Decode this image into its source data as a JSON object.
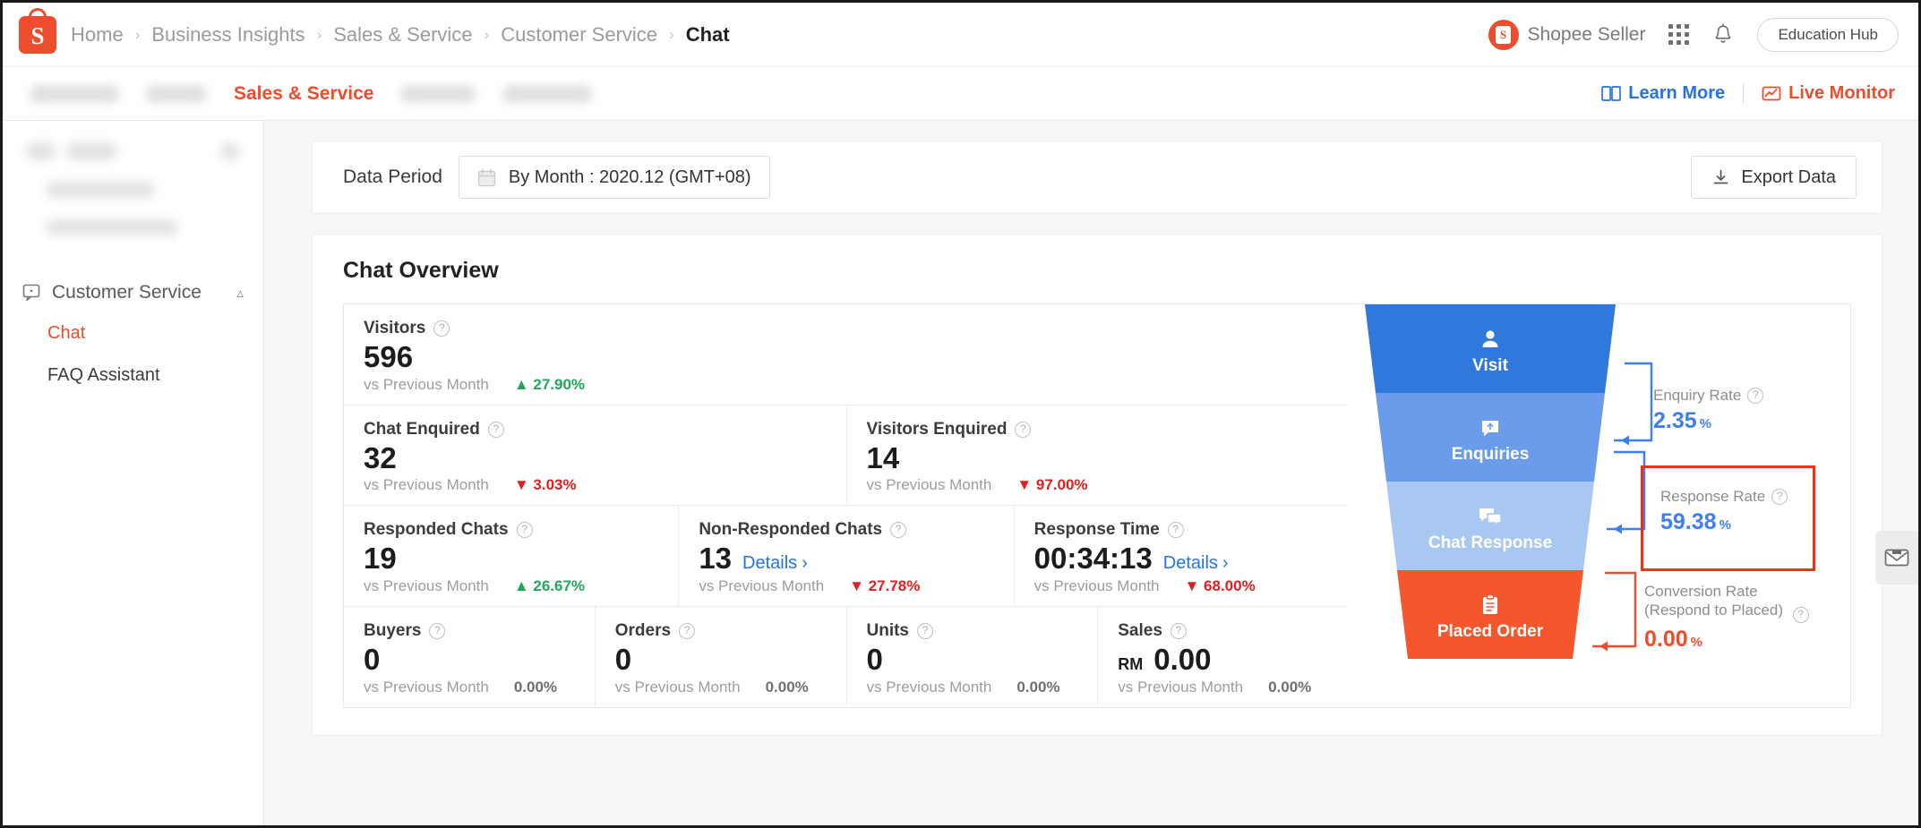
{
  "header": {
    "breadcrumb": [
      "Home",
      "Business Insights",
      "Sales & Service",
      "Customer Service",
      "Chat"
    ],
    "separator": "›",
    "seller_name": "Shopee Seller",
    "education_hub": "Education Hub",
    "icons": {
      "apps": "grid-icon",
      "notification": "bell-icon",
      "logo": "shopee-logo"
    }
  },
  "navbar": {
    "active_item": "Sales & Service",
    "redacted_widths": [
      100,
      68,
      60,
      84,
      100
    ],
    "learn_more": "Learn More",
    "live_monitor": "Live Monitor"
  },
  "sidebar": {
    "group": "Customer Service",
    "items": [
      {
        "label": "Chat",
        "active": true
      },
      {
        "label": "FAQ Assistant",
        "active": false
      }
    ]
  },
  "period": {
    "label": "Data Period",
    "value": "By Month :  2020.12 (GMT+08)",
    "export_label": "Export Data"
  },
  "overview": {
    "title": "Chat Overview",
    "vs_label": "vs Previous Month",
    "rows": [
      [
        {
          "name": "Visitors",
          "value": "596",
          "delta": "27.90%",
          "dir": "up",
          "details": null,
          "currency": null
        }
      ],
      [
        {
          "name": "Chat Enquired",
          "value": "32",
          "delta": "3.03%",
          "dir": "down",
          "details": null,
          "currency": null
        },
        {
          "name": "Visitors Enquired",
          "value": "14",
          "delta": "97.00%",
          "dir": "down",
          "details": null,
          "currency": null
        }
      ],
      [
        {
          "name": "Responded Chats",
          "value": "19",
          "delta": "26.67%",
          "dir": "up",
          "details": null,
          "currency": null
        },
        {
          "name": "Non-Responded Chats",
          "value": "13",
          "delta": "27.78%",
          "dir": "down",
          "details": "Details",
          "currency": null
        },
        {
          "name": "Response Time",
          "value": "00:34:13",
          "delta": "68.00%",
          "dir": "down",
          "details": "Details",
          "currency": null
        }
      ],
      [
        {
          "name": "Buyers",
          "value": "0",
          "delta": "0.00%",
          "dir": "flat",
          "details": null,
          "currency": null
        },
        {
          "name": "Orders",
          "value": "0",
          "delta": "0.00%",
          "dir": "flat",
          "details": null,
          "currency": null
        },
        {
          "name": "Units",
          "value": "0",
          "delta": "0.00%",
          "dir": "flat",
          "details": null,
          "currency": null
        },
        {
          "name": "Sales",
          "value": "0.00",
          "delta": "0.00%",
          "dir": "flat",
          "details": null,
          "currency": "RM"
        }
      ]
    ]
  },
  "funnel": {
    "stages": [
      {
        "label": "Visit",
        "icon": "person-icon",
        "color": "#3178dd"
      },
      {
        "label": "Enquiries",
        "icon": "chat-bubble-icon",
        "color": "#6a9ceb"
      },
      {
        "label": "Chat Response",
        "icon": "chat-response-icon",
        "color": "#a8c8f2"
      },
      {
        "label": "Placed Order",
        "icon": "clipboard-icon",
        "color": "#f4572c"
      }
    ],
    "rates": [
      {
        "name": "Enquiry Rate",
        "value": "2.35",
        "unit": "%",
        "color": "#3d7ff0",
        "highlighted": false
      },
      {
        "name": "Response Rate",
        "value": "59.38",
        "unit": "%",
        "color": "#3d7ff0",
        "highlighted": true
      },
      {
        "name": "Conversion Rate",
        "name2": "(Respond to Placed)",
        "value": "0.00",
        "unit": "%",
        "color": "#ee4d2d",
        "highlighted": false
      }
    ]
  },
  "side_tab": {
    "icon": "mail-icon"
  },
  "chart_data": {
    "type": "funnel",
    "title": "Chat Overview",
    "stages": [
      "Visit",
      "Enquiries",
      "Chat Response",
      "Placed Order"
    ],
    "values": [
      596,
      14,
      19,
      0
    ],
    "stage_colors": [
      "#3178dd",
      "#6a9ceb",
      "#a8c8f2",
      "#f4572c"
    ],
    "conversion_rates": [
      {
        "from": "Visit",
        "to": "Enquiries",
        "label": "Enquiry Rate",
        "value": 2.35,
        "unit": "%"
      },
      {
        "from": "Enquiries",
        "to": "Chat Response",
        "label": "Response Rate",
        "value": 59.38,
        "unit": "%"
      },
      {
        "from": "Chat Response",
        "to": "Placed Order",
        "label": "Conversion Rate (Respond to Placed)",
        "value": 0.0,
        "unit": "%"
      }
    ],
    "metrics": [
      {
        "name": "Visitors",
        "value": 596,
        "change_pct": 27.9,
        "direction": "up"
      },
      {
        "name": "Chat Enquired",
        "value": 32,
        "change_pct": -3.03,
        "direction": "down"
      },
      {
        "name": "Visitors Enquired",
        "value": 14,
        "change_pct": -97.0,
        "direction": "down"
      },
      {
        "name": "Responded Chats",
        "value": 19,
        "change_pct": 26.67,
        "direction": "up"
      },
      {
        "name": "Non-Responded Chats",
        "value": 13,
        "change_pct": -27.78,
        "direction": "down"
      },
      {
        "name": "Response Time",
        "value": "00:34:13",
        "change_pct": -68.0,
        "direction": "down"
      },
      {
        "name": "Buyers",
        "value": 0,
        "change_pct": 0.0,
        "direction": "flat"
      },
      {
        "name": "Orders",
        "value": 0,
        "change_pct": 0.0,
        "direction": "flat"
      },
      {
        "name": "Units",
        "value": 0,
        "change_pct": 0.0,
        "direction": "flat"
      },
      {
        "name": "Sales",
        "value": 0.0,
        "currency": "RM",
        "change_pct": 0.0,
        "direction": "flat"
      }
    ],
    "period": "2020.12 (GMT+08)",
    "comparison": "vs Previous Month"
  }
}
